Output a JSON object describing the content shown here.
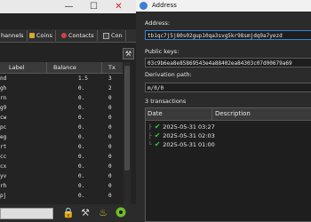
{
  "left_window": {
    "tabs": [
      {
        "label": "hannels"
      },
      {
        "label": "Coins"
      },
      {
        "label": "Contacts"
      },
      {
        "label": "Con"
      }
    ],
    "table": {
      "columns": [
        "Label",
        "Balance",
        "Tx"
      ],
      "rows": [
        {
          "key": "nd",
          "balance": "1.5",
          "tx": "3"
        },
        {
          "key": "gh",
          "balance": "0.",
          "tx": "2"
        },
        {
          "key": "rn",
          "balance": "0.",
          "tx": "0"
        },
        {
          "key": "g9",
          "balance": "0.",
          "tx": "0"
        },
        {
          "key": "cw",
          "balance": "0.",
          "tx": "0"
        },
        {
          "key": "pc",
          "balance": "0.",
          "tx": "0"
        },
        {
          "key": "eg",
          "balance": "0.",
          "tx": "0"
        },
        {
          "key": "rt",
          "balance": "0.",
          "tx": "0"
        },
        {
          "key": "cc",
          "balance": "0.",
          "tx": "0"
        },
        {
          "key": "cx",
          "balance": "0.",
          "tx": "0"
        },
        {
          "key": "yv",
          "balance": "0.",
          "tx": "0"
        },
        {
          "key": "rh",
          "balance": "0.",
          "tx": "0"
        },
        {
          "key": "pj",
          "balance": "0.",
          "tx": "0"
        }
      ]
    }
  },
  "address_dialog": {
    "title": "Address",
    "address_label": "Address:",
    "address_value": "tb1qc7j5j80s02gup10qa3svg5kr98smjdq9a7yezd",
    "pubkeys_label": "Public keys:",
    "pubkeys_value": "03c9b6ea8e85869543e4a88402ea84303c07d00679a69",
    "derivation_label": "Derivation path:",
    "derivation_value": "m/0/0",
    "transactions_count": "3 transactions",
    "tx_columns": [
      "Date",
      "Description"
    ],
    "transactions": [
      {
        "date": "2025-05-31 03:27"
      },
      {
        "date": "2025-05-31 02:03"
      },
      {
        "date": "2025-05-31 01:00"
      }
    ]
  }
}
